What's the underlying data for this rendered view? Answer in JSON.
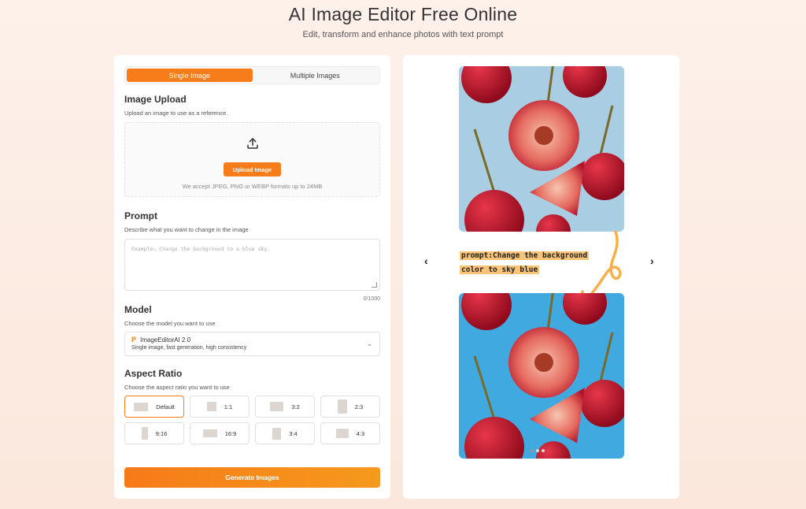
{
  "hero": {
    "title": "AI Image Editor Free Online",
    "subtitle": "Edit, transform and enhance photos with text prompt"
  },
  "tabs": [
    "Single Image",
    "Multiple Images"
  ],
  "upload": {
    "title": "Image Upload",
    "subtitle": "Upload an image to use as a reference.",
    "button": "Upload Image",
    "note": "We accept JPEG, PNG or WEBP formats up to 24MB"
  },
  "prompt": {
    "title": "Prompt",
    "subtitle": "Describe what you want to change in the image",
    "placeholder": "Example: Change the background to a blue sky.",
    "counter": "0/1000"
  },
  "model": {
    "title": "Model",
    "subtitle": "Choose the model you want to use",
    "selected_name": "ImageEditorAI 2.0",
    "selected_desc": "Single image, fast generation, high consistency"
  },
  "aspect": {
    "title": "Aspect Ratio",
    "subtitle": "Choose the aspect ratio you want to use",
    "options": [
      "Default",
      "1:1",
      "3:2",
      "2:3",
      "9:16",
      "16:9",
      "3:4",
      "4:3"
    ],
    "selected": "Default"
  },
  "generate_label": "Generate Images",
  "preview": {
    "caption_line1": "prompt:Change the background",
    "caption_line2": "color to sky blue",
    "nav_prev": "‹",
    "nav_next": "›"
  },
  "colors": {
    "accent": "#f77d1a",
    "sky_before": "#a9cde2",
    "sky_after": "#3fa9e0",
    "cherry": "#c8102e",
    "annotation_arrow": "#f5b04a"
  }
}
